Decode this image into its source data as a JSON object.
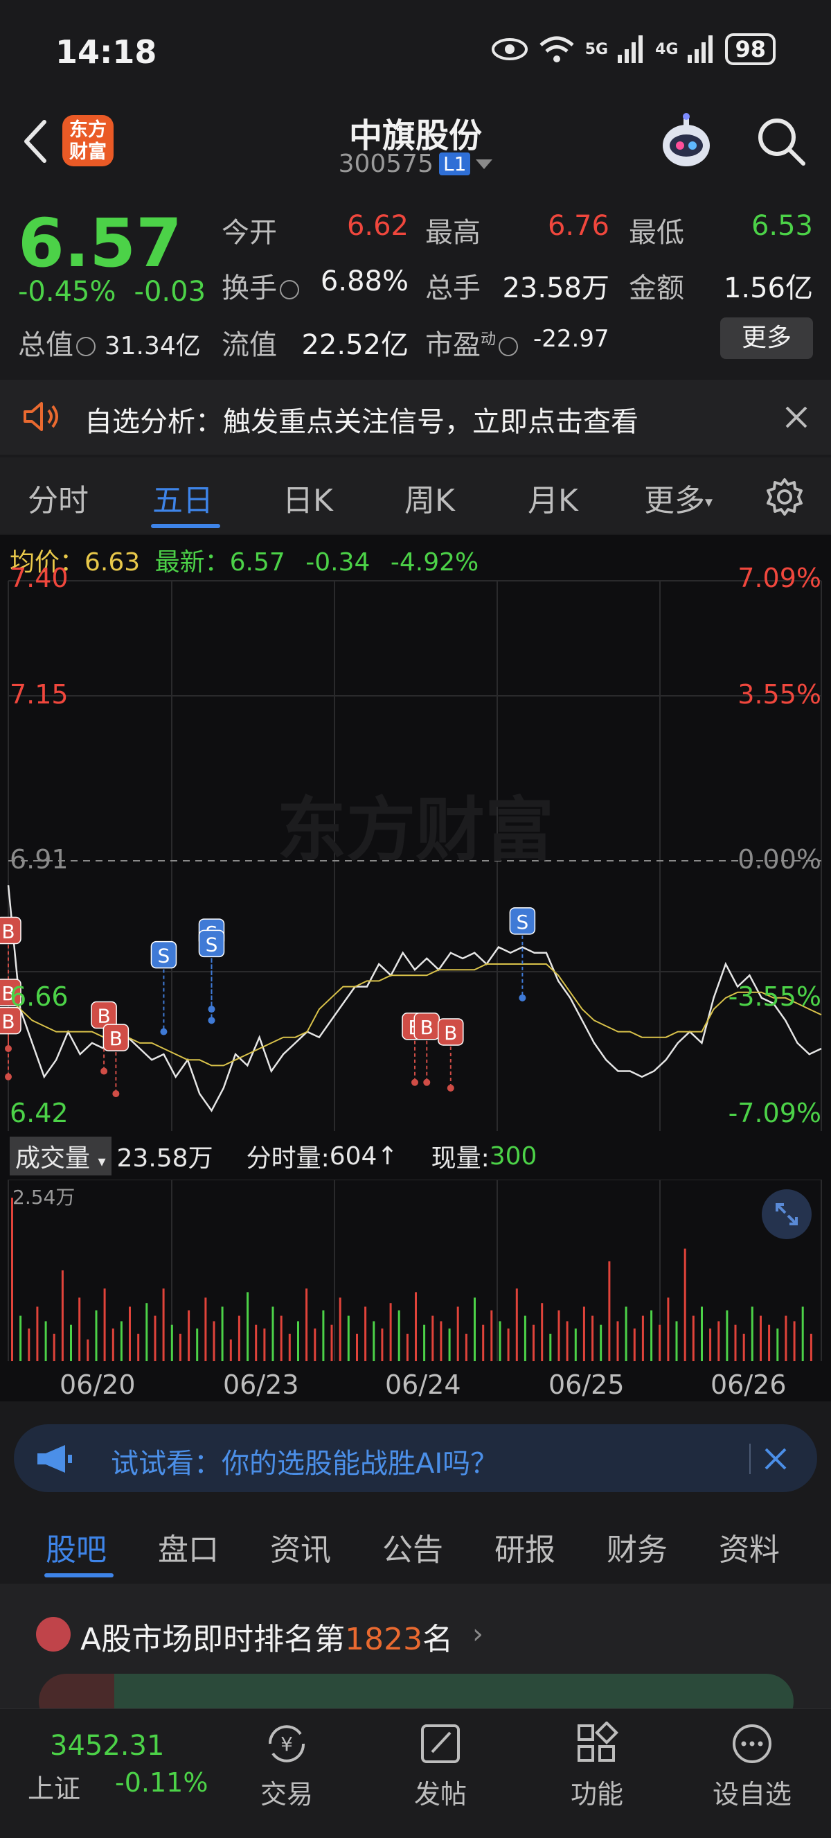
{
  "status_bar": {
    "time": "14:18",
    "battery": "98",
    "net_5g": "5G",
    "net_4g": "4G"
  },
  "header": {
    "logo_text_line1": "东方",
    "logo_text_line2": "财富",
    "title": "中旗股份",
    "code": "300575",
    "level_badge": "L1",
    "icons": [
      "back-icon",
      "robot-avatar",
      "search-icon"
    ]
  },
  "quote": {
    "price": "6.57",
    "change_pct": "-0.45%",
    "change_amt": "-0.03",
    "total_value_label": "总值",
    "total_value": "31.34亿",
    "open_label": "今开",
    "open": "6.62",
    "high_label": "最高",
    "high": "6.76",
    "low_label": "最低",
    "low": "6.53",
    "turnover_label": "换手",
    "turnover": "6.88%",
    "volume_label": "总手",
    "volume": "23.58万",
    "amount_label": "金额",
    "amount": "1.56亿",
    "float_label": "流值",
    "float_value": "22.52亿",
    "pe_label": "市盈",
    "pe_sup": "动",
    "pe": "-22.97",
    "more_button": "更多"
  },
  "alert": {
    "text": "自选分析：触发重点关注信号，立即点击查看"
  },
  "chart_tabs": {
    "items": [
      "分时",
      "五日",
      "日K",
      "周K",
      "月K",
      "更多"
    ],
    "active": "五日"
  },
  "chart_header": {
    "avg_label": "均价：",
    "avg": "6.63",
    "latest_label": "最新：",
    "latest": "6.57",
    "change": "-0.34",
    "change_pct": "-4.92%"
  },
  "chart_data": {
    "type": "line",
    "watermark": "东方财富",
    "x": [
      "06/20",
      "06/23",
      "06/24",
      "06/25",
      "06/26"
    ],
    "y_labels_left": [
      "7.40",
      "7.15",
      "6.91",
      "6.66",
      "6.42"
    ],
    "y_labels_right": [
      "7.09%",
      "3.55%",
      "0.00%",
      "-3.55%",
      "-7.09%"
    ],
    "ylim": [
      6.42,
      7.4
    ],
    "reference": 6.91,
    "series": [
      {
        "name": "最新",
        "color": "#e6e6e6",
        "values": [
          6.86,
          6.64,
          6.58,
          6.52,
          6.55,
          6.6,
          6.56,
          6.58,
          6.57,
          6.61,
          6.59,
          6.57,
          6.55,
          6.56,
          6.52,
          6.55,
          6.49,
          6.46,
          6.5,
          6.56,
          6.54,
          6.59,
          6.53,
          6.56,
          6.58,
          6.6,
          6.59,
          6.62,
          6.65,
          6.68,
          6.68,
          6.72,
          6.7,
          6.74,
          6.71,
          6.73,
          6.71,
          6.74,
          6.73,
          6.74,
          6.72,
          6.75,
          6.74,
          6.75,
          6.74,
          6.74,
          6.69,
          6.66,
          6.62,
          6.58,
          6.55,
          6.53,
          6.53,
          6.52,
          6.53,
          6.55,
          6.58,
          6.6,
          6.58,
          6.66,
          6.72,
          6.68,
          6.7,
          6.66,
          6.65,
          6.62,
          6.58,
          6.56,
          6.57
        ]
      },
      {
        "name": "均价",
        "color": "#d9c24a",
        "values": [
          6.66,
          6.64,
          6.62,
          6.61,
          6.6,
          6.6,
          6.6,
          6.6,
          6.59,
          6.59,
          6.59,
          6.58,
          6.58,
          6.57,
          6.56,
          6.55,
          6.55,
          6.54,
          6.54,
          6.55,
          6.56,
          6.57,
          6.58,
          6.59,
          6.59,
          6.6,
          6.64,
          6.66,
          6.68,
          6.68,
          6.69,
          6.69,
          6.7,
          6.7,
          6.7,
          6.7,
          6.71,
          6.71,
          6.71,
          6.71,
          6.72,
          6.72,
          6.72,
          6.72,
          6.72,
          6.72,
          6.7,
          6.67,
          6.64,
          6.62,
          6.61,
          6.6,
          6.6,
          6.59,
          6.59,
          6.59,
          6.6,
          6.6,
          6.6,
          6.64,
          6.66,
          6.67,
          6.67,
          6.67,
          6.66,
          6.66,
          6.65,
          6.64,
          6.63
        ]
      }
    ],
    "markers": [
      {
        "label": "B",
        "color": "#d04d46",
        "x_index": 0,
        "price": 6.68
      },
      {
        "label": "B",
        "color": "#d04d46",
        "x_index": 0,
        "price": 6.57
      },
      {
        "label": "B",
        "color": "#d04d46",
        "x_index": 0,
        "price": 6.52
      },
      {
        "label": "B",
        "color": "#d04d46",
        "x_index": 8,
        "price": 6.53
      },
      {
        "label": "B",
        "color": "#d04d46",
        "x_index": 9,
        "price": 6.49
      },
      {
        "label": "S",
        "color": "#3f7ad6",
        "x_index": 13,
        "price": 6.6
      },
      {
        "label": "S",
        "color": "#3f7ad6",
        "x_index": 17,
        "price": 6.64
      },
      {
        "label": "S",
        "color": "#3f7ad6",
        "x_index": 17,
        "price": 6.62
      },
      {
        "label": "B",
        "color": "#d04d46",
        "x_index": 34,
        "price": 6.51
      },
      {
        "label": "B",
        "color": "#d04d46",
        "x_index": 35,
        "price": 6.51
      },
      {
        "label": "B",
        "color": "#d04d46",
        "x_index": 37,
        "price": 6.5
      },
      {
        "label": "S",
        "color": "#3f7ad6",
        "x_index": 43,
        "price": 6.66
      }
    ]
  },
  "volume": {
    "select_label": "成交量",
    "total": "23.58万",
    "tick_label": "分时量:",
    "tick_value": "604",
    "now_label": "现量:",
    "now_value": "300",
    "max_label": "2.54万",
    "bars": [
      0.9,
      0.25,
      0.18,
      0.3,
      0.22,
      0.15,
      0.5,
      0.2,
      0.35,
      0.12,
      0.28,
      0.4,
      0.18,
      0.22,
      0.3,
      0.15,
      0.32,
      0.25,
      0.4,
      0.2,
      0.15,
      0.28,
      0.18,
      0.35,
      0.22,
      0.3,
      0.12,
      0.25,
      0.38,
      0.2,
      0.18,
      0.3,
      0.25,
      0.15,
      0.22,
      0.4,
      0.18,
      0.28,
      0.2,
      0.35,
      0.25,
      0.15,
      0.3,
      0.22,
      0.18,
      0.32,
      0.28,
      0.15,
      0.38,
      0.2,
      0.25,
      0.22,
      0.18,
      0.3,
      0.15,
      0.35,
      0.2,
      0.28,
      0.22,
      0.18,
      0.4,
      0.25,
      0.2,
      0.32,
      0.15,
      0.28,
      0.22,
      0.18,
      0.3,
      0.25,
      0.2,
      0.55,
      0.22,
      0.3,
      0.18,
      0.25,
      0.28,
      0.2,
      0.35,
      0.22,
      0.62,
      0.25,
      0.3,
      0.18,
      0.22,
      0.28,
      0.2,
      0.15,
      0.3,
      0.25,
      0.2,
      0.18,
      0.25,
      0.22,
      0.3,
      0.15
    ]
  },
  "ai_banner": {
    "text": "试试看：你的选股能战胜AI吗？"
  },
  "sub_tabs": {
    "items": [
      "股吧",
      "盘口",
      "资讯",
      "公告",
      "研报",
      "财务",
      "资料"
    ],
    "active": "股吧"
  },
  "ranking": {
    "prefix": "A股市场即时排名第",
    "rank": "1823",
    "suffix": "名"
  },
  "bottom_nav": {
    "index_value": "3452.31",
    "index_label": "上证",
    "index_change": "-0.11%",
    "items": [
      {
        "label": "交易",
        "icon": "yuan-exchange-icon"
      },
      {
        "label": "发帖",
        "icon": "edit-post-icon"
      },
      {
        "label": "功能",
        "icon": "grid-apps-icon"
      },
      {
        "label": "设自选",
        "icon": "more-dots-icon"
      }
    ]
  }
}
